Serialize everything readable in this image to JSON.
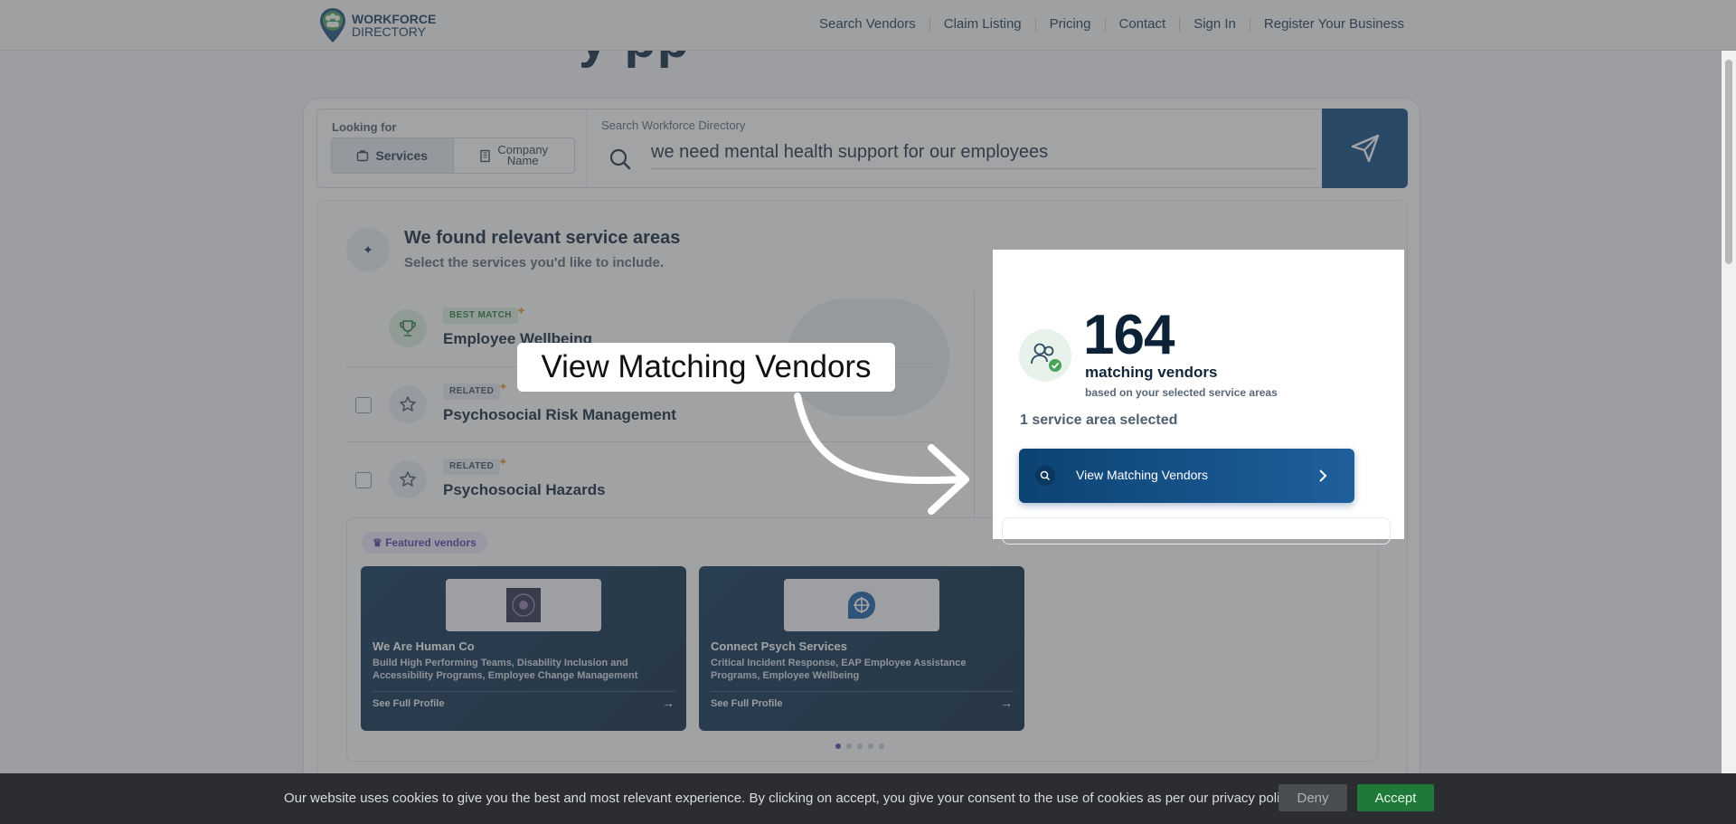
{
  "nav": {
    "logo_line1": "WORKFORCE",
    "logo_line2": "DIRECTORY",
    "links": [
      "Search Vendors",
      "Claim Listing",
      "Pricing",
      "Contact",
      "Sign In",
      "Register Your Business"
    ]
  },
  "hero": {
    "title_fragment": "y   pp"
  },
  "search": {
    "looking_for_label": "Looking for",
    "mode_services": "Services",
    "mode_company_line1": "Company",
    "mode_company_line2": "Name",
    "field_label": "Search Workforce Directory",
    "query": "we need mental health support for our employees"
  },
  "results": {
    "title": "We found relevant service areas",
    "subtitle": "Select the services you'd like to include.",
    "services": [
      {
        "tag": "BEST MATCH",
        "name": "Employee Wellbeing",
        "icon": "trophy-icon"
      },
      {
        "tag": "RELATED",
        "name": "Psychosocial Risk Management",
        "icon": "star-icon"
      },
      {
        "tag": "RELATED",
        "name": "Psychosocial Hazards",
        "icon": "star-icon"
      }
    ]
  },
  "matches": {
    "count": "164",
    "label": "matching vendors",
    "sub": "based on your selected service areas",
    "selected": "1 service area selected",
    "button": "View Matching Vendors"
  },
  "featured": {
    "pill": "Featured vendors",
    "vendors": [
      {
        "name": "We Are Human Co",
        "desc": "Build High Performing Teams, Disability Inclusion and Accessibility Programs, Employee Change Management",
        "link": "See Full Profile"
      },
      {
        "name": "Connect Psych Services",
        "desc": "Critical Incident Response, EAP Employee Assistance Programs, Employee Wellbeing",
        "link": "See Full Profile"
      }
    ]
  },
  "callout": {
    "text": "View Matching Vendors"
  },
  "cookie": {
    "text": "Our website uses cookies to give you the best and most relevant experience. By clicking on accept, you give your consent to the use of cookies as per our privacy policy.",
    "deny": "Deny",
    "accept": "Accept"
  },
  "colors": {
    "brand": "#0d4a82",
    "accept": "#1f7a3a",
    "best_match": "#2b7a3d"
  }
}
